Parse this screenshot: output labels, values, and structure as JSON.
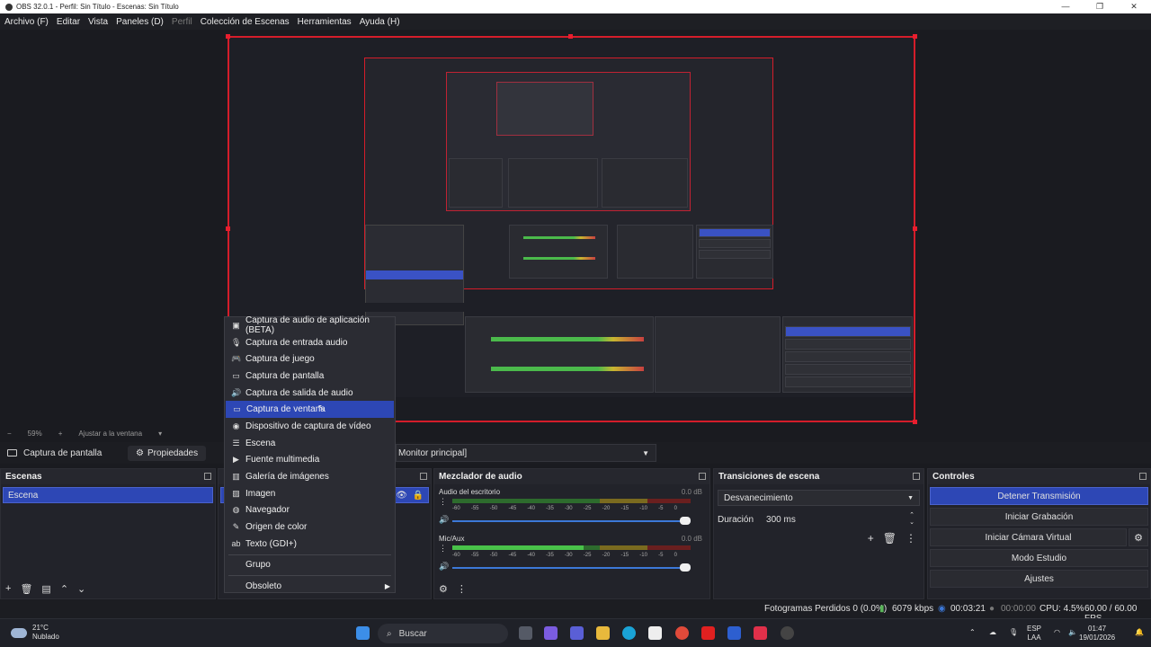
{
  "window": {
    "title": "OBS 32.0.1 - Perfil: Sin Título - Escenas: Sin Título",
    "minimize": "—",
    "maximize": "❐",
    "close": "✕"
  },
  "menubar": [
    "Archivo (F)",
    "Editar",
    "Vista",
    "Paneles (D)",
    "Perfil",
    "Colección de Escenas",
    "Herramientas",
    "Ayuda (H)"
  ],
  "zoom": {
    "value": "59%",
    "fit": "Ajustar a la ventana"
  },
  "source_bar": {
    "source_name": "Captura de pantalla",
    "properties": "Propiedades",
    "monitor": "Monitor principal]"
  },
  "context_menu": {
    "items": [
      {
        "label": "Captura de audio de aplicación (BETA)",
        "icon": "app-audio-icon"
      },
      {
        "label": "Captura de entrada audio",
        "icon": "mic-icon"
      },
      {
        "label": "Captura de juego",
        "icon": "gamepad-icon"
      },
      {
        "label": "Captura de pantalla",
        "icon": "monitor-icon"
      },
      {
        "label": "Captura de salida de audio",
        "icon": "speaker-icon"
      },
      {
        "label": "Captura de ventana",
        "icon": "window-icon",
        "selected": true
      },
      {
        "label": "Dispositivo de captura de vídeo",
        "icon": "camera-icon"
      },
      {
        "label": "Escena",
        "icon": "list-icon"
      },
      {
        "label": "Fuente multimedia",
        "icon": "play-icon"
      },
      {
        "label": "Galería de imágenes",
        "icon": "gallery-icon"
      },
      {
        "label": "Imagen",
        "icon": "image-icon"
      },
      {
        "label": "Navegador",
        "icon": "globe-icon"
      },
      {
        "label": "Origen de color",
        "icon": "brush-icon"
      },
      {
        "label": "Texto (GDI+)",
        "icon": "text-icon"
      }
    ],
    "group": "Grupo",
    "deprecated": "Obsoleto"
  },
  "scenes": {
    "title": "Escenas",
    "items": [
      "Escena"
    ]
  },
  "mixer": {
    "title": "Mezclador de audio",
    "channels": [
      {
        "name": "Audio del escritorio",
        "db": "0.0 dB",
        "level": 0.0
      },
      {
        "name": "Mic/Aux",
        "db": "0.0 dB",
        "level": 0.55
      }
    ],
    "scale": [
      "-60",
      "-55",
      "-50",
      "-45",
      "-40",
      "-35",
      "-30",
      "-25",
      "-20",
      "-15",
      "-10",
      "-5",
      "0"
    ]
  },
  "transitions": {
    "title": "Transiciones de escena",
    "selected": "Desvanecimiento",
    "duration_label": "Duración",
    "duration_value": "300 ms"
  },
  "controls": {
    "title": "Controles",
    "buttons": [
      "Detener Transmisión",
      "Iniciar Grabación",
      "Iniciar Cámara Virtual",
      "Modo Estudio",
      "Ajustes"
    ]
  },
  "status": {
    "dropped": "Fotogramas Perdidos 0 (0.0%)",
    "bitrate": "6079 kbps",
    "stream_time": "00:03:21",
    "rec_time": "00:00:00",
    "cpu": "CPU: 4.5%",
    "fps": "60.00 / 60.00 FPS"
  },
  "taskbar": {
    "weather_temp": "21°C",
    "weather_desc": "Nublado",
    "search": "Buscar",
    "lang1": "ESP",
    "lang2": "LAA",
    "time": "01:47",
    "date": "19/01/2026"
  },
  "colors": {
    "accent": "#2d47b5",
    "selection_border": "#d41d2a"
  }
}
